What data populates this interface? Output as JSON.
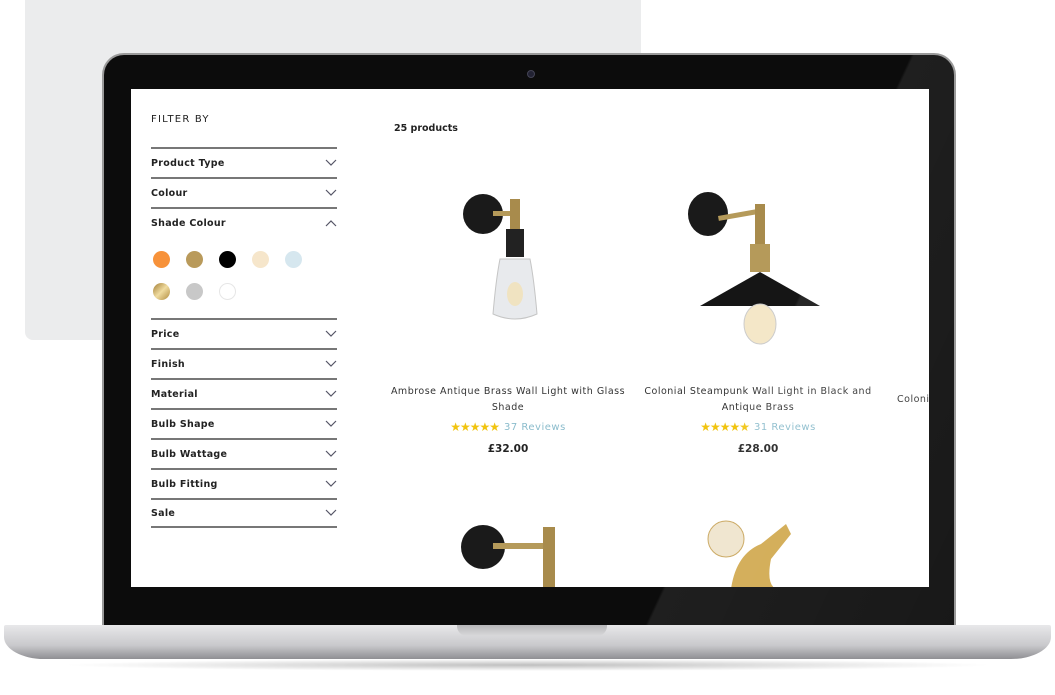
{
  "filters": {
    "title": "FILTER BY",
    "items": [
      "Product Type",
      "Colour",
      "Shade Colour",
      "Price",
      "Finish",
      "Material",
      "Bulb Shape",
      "Bulb Wattage",
      "Bulb Fitting",
      "Sale"
    ],
    "shade_colours": [
      "#f7923a",
      "#b99a5b",
      "#000000",
      "#f6e6cb",
      "#d6e7ef",
      "#c8a45a",
      "#c8c8c8",
      "#ffffff"
    ]
  },
  "results": {
    "count": "25 products"
  },
  "products": [
    {
      "name": "Ambrose Antique Brass Wall Light with Glass Shade",
      "rating": 5,
      "reviews": "37 Reviews",
      "price": "£32.00"
    },
    {
      "name": "Colonial Steampunk Wall Light in Black and Antique Brass",
      "rating": 5,
      "reviews": "31 Reviews",
      "price": "£28.00"
    },
    {
      "name": "Coloni"
    }
  ],
  "colors": {
    "star": "#f1c40f",
    "reviews": "#8bbccc"
  }
}
